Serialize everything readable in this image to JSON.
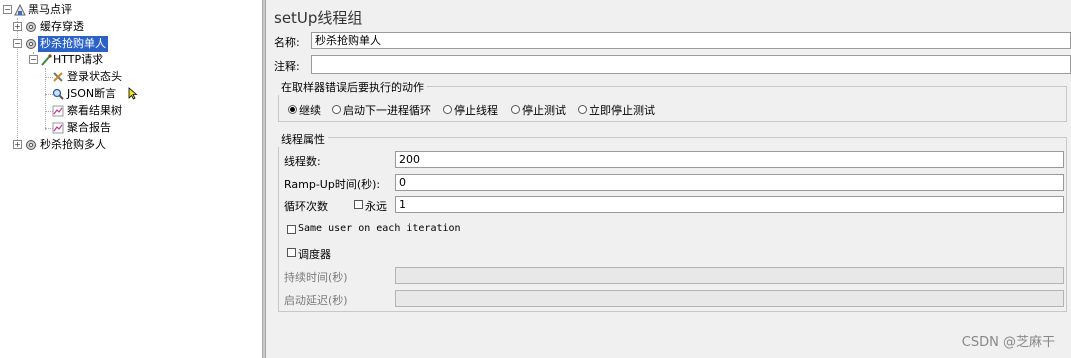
{
  "tree": {
    "root": "黑马点评",
    "items": {
      "cache": "缓存穿透",
      "flash_single": "秒杀抢购单人",
      "http_request": "HTTP请求",
      "login_header": "登录状态头",
      "json_assert": "JSON断言",
      "view_results": "察看结果树",
      "aggregate": "聚合报告",
      "flash_multi": "秒杀抢购多人"
    }
  },
  "panel": {
    "title": "setUp线程组",
    "name_label": "名称:",
    "name_value": "秒杀抢购单人",
    "comment_label": "注释:",
    "comment_value": "",
    "error_action": {
      "title": "在取样器错误后要执行的动作",
      "options": [
        "继续",
        "启动下一进程循环",
        "停止线程",
        "停止测试",
        "立即停止测试"
      ],
      "selected": "继续"
    },
    "thread_props": {
      "title": "线程属性",
      "threads_label": "线程数:",
      "threads_value": "200",
      "rampup_label": "Ramp-Up时间(秒):",
      "rampup_value": "0",
      "loop_label": "循环次数",
      "forever_label": "永远",
      "loop_value": "1",
      "same_user_label": "Same user on each iteration",
      "scheduler_label": "调度器",
      "duration_label": "持续时间(秒)",
      "duration_value": "",
      "delay_label": "启动延迟(秒)",
      "delay_value": ""
    }
  },
  "watermark": "CSDN @芝麻干",
  "colors": {
    "selection": "#2b62c4",
    "panel_bg": "#f0f0f0"
  }
}
